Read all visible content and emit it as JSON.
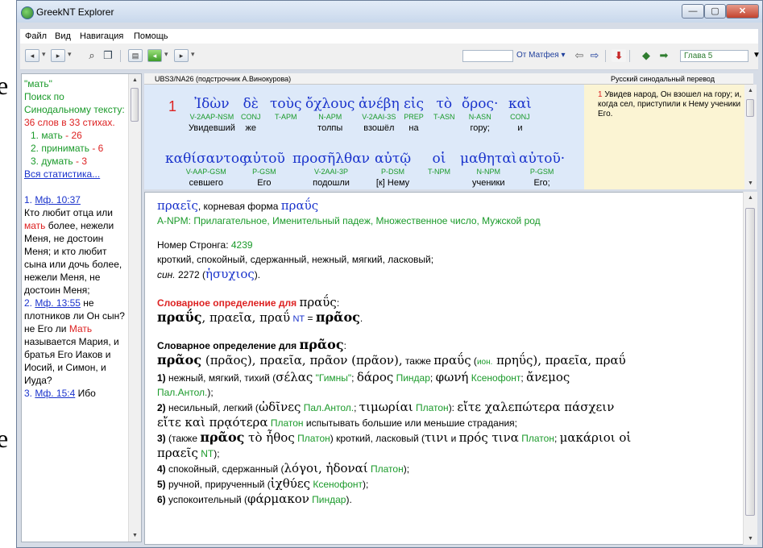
{
  "background_fragments": [
    "e",
    "e"
  ],
  "window": {
    "title": "GreekNT Explorer",
    "controls": {
      "minimize": "—",
      "maximize": "▢",
      "close": "✕"
    }
  },
  "menu": [
    "Файл",
    "Вид",
    "Навигация",
    "Помощь"
  ],
  "toolbar": {
    "book": "От Матфея",
    "chapter": "Глава 5"
  },
  "search_results": {
    "query": "\"мать\"",
    "summary_prefix": "Поиск по Синодальному тексту: ",
    "summary_count": "36 слов в 33 стихах.",
    "stats": [
      {
        "num": "1.",
        "word": "мать",
        "count": "- 26"
      },
      {
        "num": "2.",
        "word": "принимать",
        "count": "- 6"
      },
      {
        "num": "3.",
        "word": "думать",
        "count": "- 3"
      }
    ],
    "all_stats": "Вся статистика...",
    "results": [
      {
        "num": "1.",
        "ref": "Мф. 10:37",
        "text_before": "Кто любит отца или ",
        "highlight": "мать",
        "text_after": " более, нежели Меня, не достоин Меня; и кто любит сына или дочь более, нежели Меня, не достоин Меня;"
      },
      {
        "num": "2.",
        "ref": "Мф. 13:55",
        "text_before": " не плотников ли Он сын? не Его ли ",
        "highlight": "Мать",
        "text_after": " называется Мария, и братья Его Иаков и Иосий, и Симон, и Иуда?"
      },
      {
        "num": "3.",
        "ref": "Мф. 15:4",
        "text_before": " Ибо",
        "highlight": "",
        "text_after": ""
      }
    ]
  },
  "interlinear": {
    "header": "UBS3/NA26 (подстрочник А.Винокурова)",
    "verse_num": "1",
    "words": [
      {
        "greek": "Ἰδὼν",
        "morph": "V-2AAP-NSM",
        "rus": "Увидевший"
      },
      {
        "greek": "δὲ",
        "morph": "CONJ",
        "rus": "же"
      },
      {
        "greek": "τοὺς",
        "morph": "T-APM",
        "rus": ""
      },
      {
        "greek": "ὄχλους",
        "morph": "N-APM",
        "rus": "толпы"
      },
      {
        "greek": "ἀνέβη",
        "morph": "V-2AAI-3S",
        "rus": "взошёл"
      },
      {
        "greek": "εἰς",
        "morph": "PREP",
        "rus": "на"
      },
      {
        "greek": "τὸ",
        "morph": "T-ASN",
        "rus": ""
      },
      {
        "greek": "ὄρος·",
        "morph": "N-ASN",
        "rus": "гору;"
      },
      {
        "greek": "καὶ",
        "morph": "CONJ",
        "rus": "и"
      },
      {
        "greek": "καθίσαντος",
        "morph": "V-AAP-GSM",
        "rus": "севшего"
      },
      {
        "greek": "αὐτοῦ",
        "morph": "P-GSM",
        "rus": "Его"
      },
      {
        "greek": "προσῆλθαν",
        "morph": "V-2AAI-3P",
        "rus": "подошли"
      },
      {
        "greek": "αὐτῷ",
        "morph": "P-DSM",
        "rus": "[к] Нему"
      },
      {
        "greek": "οἱ",
        "morph": "T-NPM",
        "rus": ""
      },
      {
        "greek": "μαθηταὶ",
        "morph": "N-NPM",
        "rus": "ученики"
      },
      {
        "greek": "αὐτοῦ·",
        "morph": "P-GSM",
        "rus": "Его;"
      }
    ]
  },
  "translation": {
    "header": "Русский синодальный перевод",
    "verse_num": "1",
    "text": "Увидев народ, Он взошел на гору; и, когда сел, приступили к Нему ученики Его."
  },
  "dictionary": {
    "word": "πραεῖς",
    "root_label": ", корневая форма ",
    "root": "πραΰς",
    "morph": "A-NPM: Прилагательное, Именительный падеж, Множественное число, Мужской род",
    "strong_label": "Номер Стронга: ",
    "strong_num": "4239",
    "meanings": "кроткий, спокойный, сдержанный, нежный, мягкий, ласковый;",
    "syn_label": "син.",
    "syn_num": "2272",
    "syn_word": "ἡσυχιος",
    "def1_label": "Словарное определение для",
    "def1_word": "πραΰς",
    "def1_line_a": "πραΰς",
    "def1_line_b": ", πραεῖα, πραΰ",
    "def1_nt": "NT",
    "def1_eq": " = ",
    "def1_line_c": "πρᾶος",
    "def2_label": "Словарное определение для",
    "def2_word": "πρᾶος",
    "def2_head_a": "πρᾶος",
    "def2_head_b": " (πρᾶος), πραεῖα, πρᾶον (πρᾶον),",
    "def2_head_c": " также ",
    "def2_head_d": "πραΰς",
    "def2_head_e": " (",
    "def2_head_ion": "ион.",
    "def2_head_f": " πρηΰς), πραεῖα, πραΰ",
    "sense1_a": "1)",
    "sense1_b": " нежный, мягкий, тихий (",
    "sense1_c": "σέλας",
    "sense1_d": " \"Гимны\"",
    "sense1_e": "; ",
    "sense1_f": "δάρος",
    "sense1_g": " Пиндар",
    "sense1_h": "; ",
    "sense1_i": "φωνή",
    "sense1_j": " Ксенофонт",
    "sense1_k": "; ",
    "sense1_l": "ἄνεμος",
    "sense1_m": "Пал.Антол.",
    "sense1_n": ");",
    "sense2_a": "2)",
    "sense2_b": " несильный, легкий (",
    "sense2_c": "ὠδῖνες",
    "sense2_d": " Пал.Антол.",
    "sense2_e": "; ",
    "sense2_f": "τιμωρίαι",
    "sense2_g": " Платон",
    "sense2_h": "): ",
    "sense2_i": "εἴτε χαλεπώτερα πάσχειν",
    "sense2_j": "εἴτε καὶ πρᾳότερα",
    "sense2_k": " Платон",
    "sense2_l": " испытывать большие или меньшие страдания;",
    "sense3_a": "3)",
    "sense3_b": " (также ",
    "sense3_c": "πρᾶος",
    "sense3_d": " τὸ ἦθος",
    "sense3_e": " Платон",
    "sense3_f": ") кроткий, ласковый (",
    "sense3_g": "τινι",
    "sense3_h": " и ",
    "sense3_i": "πρός τινα",
    "sense3_j": " Платон",
    "sense3_k": "; ",
    "sense3_l": "μακάριοι οἱ",
    "sense3_m": "πραεῖς",
    "sense3_n": " NT",
    "sense3_o": ");",
    "sense4_a": "4)",
    "sense4_b": " спокойный, сдержанный (",
    "sense4_c": "λόγοι, ἡδοναί",
    "sense4_d": " Платон",
    "sense4_e": ");",
    "sense5_a": "5)",
    "sense5_b": " ручной, прирученный (",
    "sense5_c": "ἰχθύες",
    "sense5_d": " Ксенофонт",
    "sense5_e": ");",
    "sense6_a": "6)",
    "sense6_b": " успокоительный (",
    "sense6_c": "φάρμακον",
    "sense6_d": " Пиндар",
    "sense6_e": ")."
  },
  "colors": {
    "greek": "#1a33cc",
    "morph": "#1a9a2a",
    "verse_number": "#d22222",
    "interlinear_bg": "#dde9f9",
    "translation_bg": "#fbf4d3"
  },
  "icons": [
    "app-globe-icon",
    "back-icon",
    "forward-icon",
    "binoculars-icon",
    "copy-icon",
    "layout-icon",
    "green-nav-icon",
    "page-icon",
    "prev-page-icon",
    "next-page-icon",
    "bookmark-icon",
    "prev-chapter-icon",
    "next-chapter-icon"
  ]
}
